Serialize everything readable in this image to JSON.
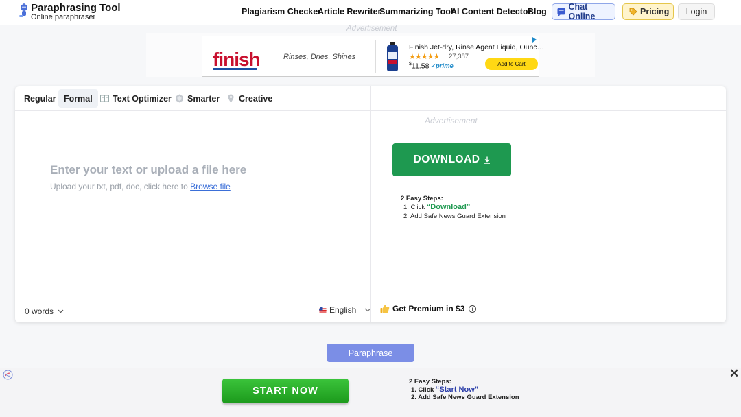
{
  "header": {
    "logo_title": "Paraphrasing Tool",
    "logo_subtitle": "Online paraphraser",
    "nav": [
      "Plagiarism Checker",
      "Article Rewriter",
      "Summarizing Tool",
      "AI Content Detector",
      "Blog"
    ],
    "chat_label": "Chat Online",
    "pricing_label": "Pricing",
    "login_label": "Login"
  },
  "top_ad": {
    "label": "Advertisement",
    "brand": "finish",
    "tagline": "Rinses, Dries, Shines",
    "product_title": "Finish Jet-dry, Rinse Agent Liquid, Ounc…",
    "stars": "★★★★★",
    "rating_count": "27,387",
    "price_symbol": "$",
    "price": "11.58",
    "prime": "✓prime",
    "cart_label": "Add to Cart"
  },
  "editor": {
    "modes": [
      "Regular",
      "Formal",
      "Text Optimizer",
      "Smarter",
      "Creative"
    ],
    "active_mode": "Formal",
    "placeholder": "Enter your text or upload a file here",
    "upload_hint": "Upload your txt, pdf, doc, click here to ",
    "browse_label": "Browse file",
    "word_count": "0 words",
    "language": "English"
  },
  "right_panel": {
    "ad_label": "Advertisement",
    "download_label": "DOWNLOAD",
    "steps_title": "2 Easy Steps:",
    "step1_prefix": "1. Click ",
    "step1_highlight": "“Download”",
    "step2": "2. Add Safe News Guard Extension",
    "premium_label": "Get Premium in $3"
  },
  "paraphrase_label": "Paraphrase",
  "bottom_ad": {
    "start_label": "START NOW",
    "steps_title": "2 Easy Steps:",
    "step1_prefix": "1. Click ",
    "step1_highlight": "“Start Now”",
    "step2": "2. Add Safe News Guard Extension",
    "close": "✕"
  },
  "colors": {
    "download_green": "#1e9950",
    "paraphrase_blue": "#7b8ee6",
    "start_green": "#2ab02a"
  }
}
